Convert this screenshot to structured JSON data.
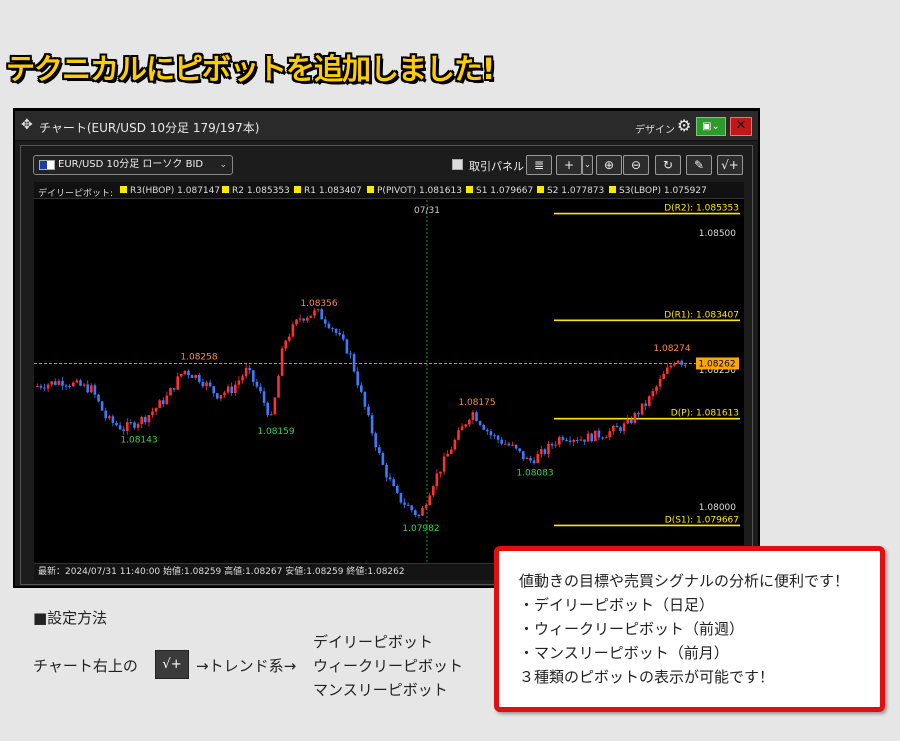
{
  "headline": "テクニカルにピボットを追加しました!",
  "window": {
    "title": "チャート(EUR/USD 10分足 179/197本)",
    "design_label": "デザイン",
    "icons": {
      "move": "move-icon",
      "gear": "gear-icon",
      "close": "close-icon"
    }
  },
  "toolbar": {
    "symbol": "EUR/USD 10分足 ローソク BID",
    "torihiki_panel": "取引パネル",
    "tools": [
      "indicator-list-icon",
      "crosshair-icon",
      "zoom-in-icon",
      "zoom-out-icon",
      "refresh-icon",
      "pen-icon",
      "technical-add-icon"
    ]
  },
  "legend": {
    "label": "デイリーピボット:",
    "items": [
      "R3(HBOP) 1.087147",
      "R2 1.085353",
      "R1 1.083407",
      "P(PIVOT) 1.081613",
      "S1 1.079667",
      "S2 1.077873",
      "S3(LBOP) 1.075927"
    ]
  },
  "status_bar": "最新：2024/07/31 11:40:00 始値:1.08259 高値:1.08267 安値:1.08259 終値:1.08262",
  "chart_data": {
    "type": "candlestick",
    "date_marker": "07/31",
    "y_ticks": [
      "1.08500",
      "1.08250",
      "1.08000"
    ],
    "current_price": "1.08262",
    "pivot_lines": [
      {
        "label": "D(R2): 1.085353",
        "value": 1.085353
      },
      {
        "label": "D(R1): 1.083407",
        "value": 1.083407
      },
      {
        "label": "D(P): 1.081613",
        "value": 1.081613
      },
      {
        "label": "D(S1): 1.079667",
        "value": 1.079667
      }
    ],
    "annotations": {
      "highs": [
        "1.08356",
        "1.08258",
        "1.08175",
        "1.08274"
      ],
      "lows": [
        "1.08143",
        "1.08159",
        "1.07982",
        "1.08083"
      ]
    },
    "colors": {
      "up": "#ff3030",
      "down": "#3a7bff",
      "pivot": "#ffe600",
      "low_label": "#2dd84a",
      "high_label": "#ff8a3a",
      "current": "#ffa500"
    }
  },
  "setup": {
    "title": "■設定方法",
    "lead": "チャート右上の",
    "icon": "technical-add-icon",
    "trend": "→トレンド系→",
    "options": [
      "デイリーピボット",
      "ウィークリーピボット",
      "マンスリーピボット"
    ]
  },
  "callout": {
    "lines": [
      "値動きの目標や売買シグナルの分析に便利です！",
      "・デイリーピボット（日足）",
      "・ウィークリーピボット（前週）",
      "・マンスリーピボット（前月）",
      "３種類のピボットの表示が可能です！"
    ]
  }
}
